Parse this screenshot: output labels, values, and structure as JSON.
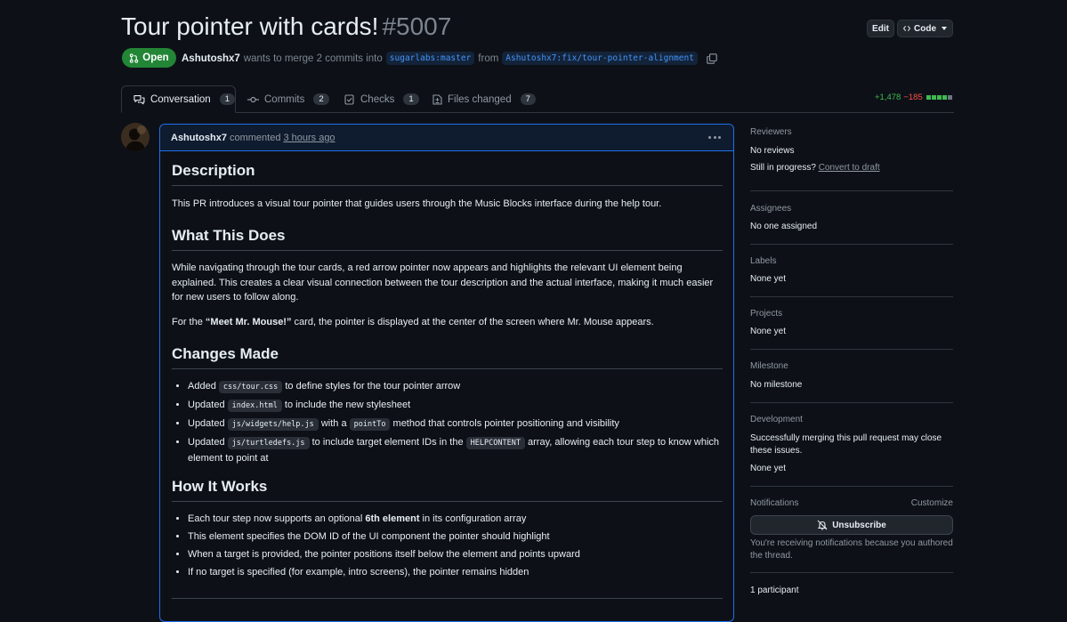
{
  "header": {
    "title": "Tour pointer with cards!",
    "number": "#5007",
    "edit_label": "Edit",
    "code_label": "Code",
    "state": "Open",
    "author": "Ashutoshx7",
    "merge_text": "wants to merge 2 commits into",
    "base_branch": "sugarlabs:master",
    "from_text": "from",
    "head_branch": "Ashutoshx7:fix/tour-pointer-alignment"
  },
  "tabs": [
    {
      "label": "Conversation",
      "count": "1"
    },
    {
      "label": "Commits",
      "count": "2"
    },
    {
      "label": "Checks",
      "count": "1"
    },
    {
      "label": "Files changed",
      "count": "7"
    }
  ],
  "diffstat": {
    "additions": "+1,478",
    "deletions": "−185"
  },
  "comment": {
    "author": "Ashutoshx7",
    "action": "commented",
    "time": "3 hours ago",
    "h_description": "Description",
    "p_description": "This PR introduces a visual tour pointer that guides users through the Music Blocks interface during the help tour.",
    "h_what": "What This Does",
    "p_what": "While navigating through the tour cards, a red arrow pointer now appears and highlights the relevant UI element being explained. This creates a clear visual connection between the tour description and the actual interface, making it much easier for new users to follow along.",
    "p_mouse_pre": "For the ",
    "p_mouse_bold": "“Meet Mr. Mouse!”",
    "p_mouse_post": " card, the pointer is displayed at the center of the screen where Mr. Mouse appears.",
    "h_changes": "Changes Made",
    "changes": [
      {
        "pre": "Added ",
        "code": "css/tour.css",
        "post": " to define styles for the tour pointer arrow"
      },
      {
        "pre": "Updated ",
        "code": "index.html",
        "post": " to include the new stylesheet"
      },
      {
        "pre": "Updated ",
        "code": "js/widgets/help.js",
        "mid": " with a ",
        "code2": "pointTo",
        "post": " method that controls pointer positioning and visibility"
      },
      {
        "pre": "Updated ",
        "code": "js/turtledefs.js",
        "mid": " to include target element IDs in the ",
        "code2": "HELPCONTENT",
        "post": " array, allowing each tour step to know which element to point at"
      }
    ],
    "h_how": "How It Works",
    "how": [
      {
        "pre": "Each tour step now supports an optional ",
        "bold": "6th element",
        "post": " in its configuration array"
      },
      {
        "pre": "This element specifies the DOM ID of the UI component the pointer should highlight"
      },
      {
        "pre": "When a target is provided, the pointer positions itself below the element and points upward"
      },
      {
        "pre": "If no target is specified (for example, intro screens), the pointer remains hidden"
      }
    ]
  },
  "sidebar": {
    "reviewers_label": "Reviewers",
    "reviewers_value": "No reviews",
    "progress_text": "Still in progress?",
    "convert_link": "Convert to draft",
    "assignees_label": "Assignees",
    "assignees_value": "No one assigned",
    "labels_label": "Labels",
    "labels_value": "None yet",
    "projects_label": "Projects",
    "projects_value": "None yet",
    "milestone_label": "Milestone",
    "milestone_value": "No milestone",
    "development_label": "Development",
    "development_text": "Successfully merging this pull request may close these issues.",
    "development_value": "None yet",
    "notifications_label": "Notifications",
    "customize_link": "Customize",
    "unsubscribe_label": "Unsubscribe",
    "notification_reason": "You're receiving notifications because you authored the thread.",
    "participants": "1 participant"
  },
  "colors": {
    "accent": "#1f6feb",
    "open": "#238636",
    "add": "#3fb950",
    "del": "#f85149"
  }
}
